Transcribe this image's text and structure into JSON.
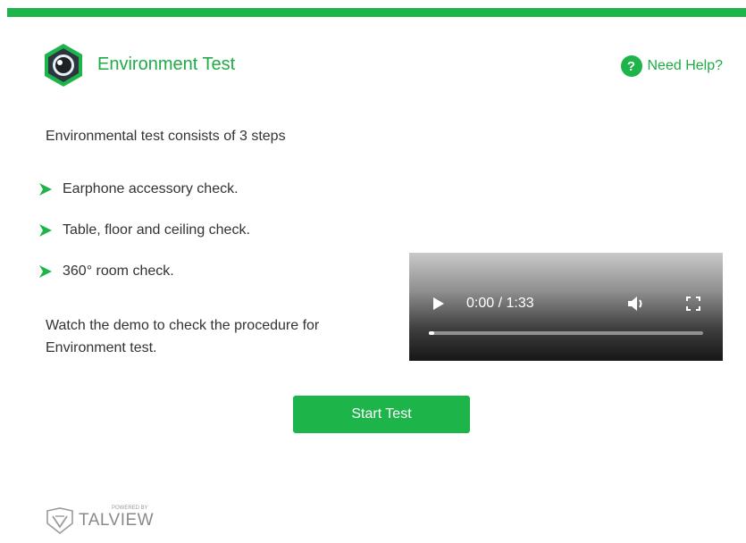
{
  "colors": {
    "accent": "#1db54a",
    "title_green": "#1fab46",
    "text": "#333333"
  },
  "header": {
    "logo_icon": "camera-lens-hexagon-icon",
    "title": "Environment Test",
    "help": {
      "icon": "question-circle-icon",
      "icon_glyph": "?",
      "label": "Need Help?"
    }
  },
  "content": {
    "intro": "Environmental test consists of 3 steps",
    "step_icon": "green-arrow-icon",
    "steps": [
      "Earphone accessory check.",
      "Table, floor and ceiling check.",
      "360° room check."
    ],
    "demo_text": "Watch the demo to check the procedure for Environment test."
  },
  "video": {
    "time_display": "0:00 / 1:33",
    "progress": 0.0,
    "controls": [
      "play-icon",
      "volume-icon",
      "fullscreen-icon"
    ]
  },
  "actions": {
    "start_label": "Start Test"
  },
  "footer": {
    "powered_by": "POWERED BY",
    "brand": "TALVIEW",
    "logo_icon": "talview-shield-icon"
  }
}
